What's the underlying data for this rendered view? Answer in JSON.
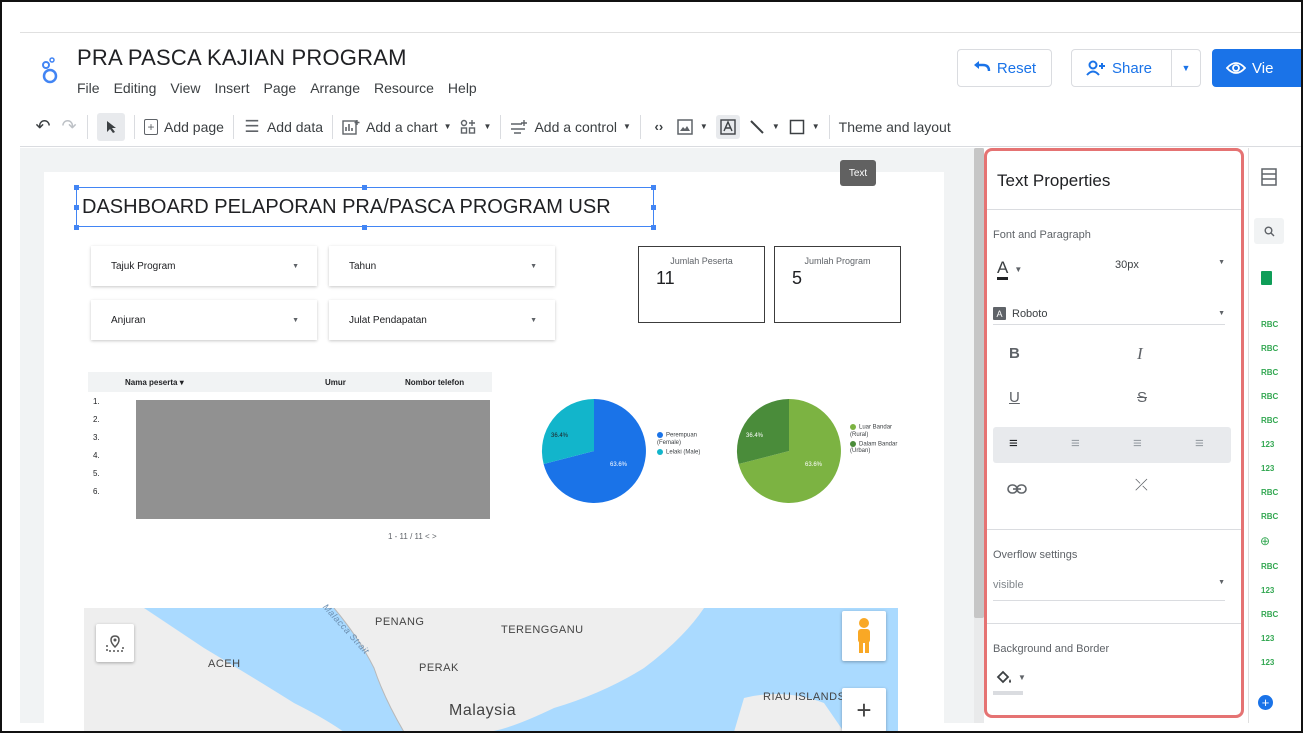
{
  "app": {
    "title": "PRA PASCA KAJIAN PROGRAM",
    "menu": [
      "File",
      "Editing",
      "View",
      "Insert",
      "Page",
      "Arrange",
      "Resource",
      "Help"
    ],
    "reset_label": "Reset",
    "share_label": "Share",
    "view_label": "Vie"
  },
  "toolbar": {
    "add_page": "Add page",
    "add_data": "Add data",
    "add_chart": "Add a chart",
    "add_control": "Add a control",
    "theme_layout": "Theme and layout",
    "tooltip": "Text"
  },
  "dashboard": {
    "title": "DASHBOARD PELAPORAN PRA/PASCA PROGRAM USR",
    "filters": [
      {
        "label": "Tajuk Program"
      },
      {
        "label": "Tahun"
      },
      {
        "label": "Anjuran"
      },
      {
        "label": "Julat Pendapatan"
      }
    ],
    "scorecards": [
      {
        "label": "Jumlah Peserta",
        "value": "11"
      },
      {
        "label": "Jumlah Program",
        "value": "5"
      }
    ],
    "table": {
      "headers": [
        "Nama peserta ▾",
        "Umur",
        "Nombor telefon"
      ],
      "row_numbers": [
        "1.",
        "2.",
        "3.",
        "4.",
        "5.",
        "6."
      ],
      "pagination": "1 - 11 / 11   <   >"
    },
    "pies": [
      {
        "colors": [
          "#1a73e8",
          "#12b5cb"
        ],
        "labels": [
          "63.6%",
          "36.4%"
        ],
        "legend": [
          "Perempuan (Female)",
          "Lelaki (Male)"
        ]
      },
      {
        "colors": [
          "#7cb342",
          "#4a8c3a"
        ],
        "labels": [
          "63.6%",
          "36.4%"
        ],
        "legend": [
          "Luar Bandar (Rural)",
          "Dalam Bandar (Urban)"
        ]
      }
    ],
    "map": {
      "labels": [
        "PENANG",
        "TERENGGANU",
        "ACEH",
        "PERAK",
        "Malacca Strait",
        "RIAU ISLANDS",
        "Malaysia"
      ]
    }
  },
  "panel": {
    "title": "Text Properties",
    "font_section": "Font and Paragraph",
    "font_size": "30px",
    "font_name": "Roboto",
    "overflow_section": "Overflow settings",
    "overflow_value": "visible",
    "bg_section": "Background and Border"
  },
  "rail": {
    "fields": [
      "RBC",
      "RBC",
      "RBC",
      "RBC",
      "RBC",
      "123",
      "123",
      "RBC",
      "RBC",
      "RBC",
      "123",
      "RBC",
      "123",
      "123"
    ]
  }
}
